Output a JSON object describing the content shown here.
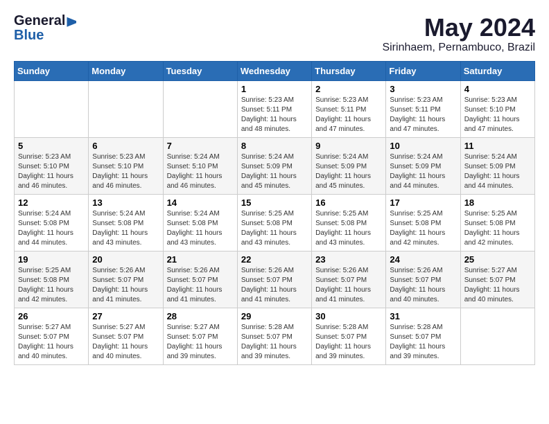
{
  "logo": {
    "general": "General",
    "blue": "Blue"
  },
  "title": "May 2024",
  "subtitle": "Sirinhaem, Pernambuco, Brazil",
  "weekdays": [
    "Sunday",
    "Monday",
    "Tuesday",
    "Wednesday",
    "Thursday",
    "Friday",
    "Saturday"
  ],
  "weeks": [
    [
      {
        "day": "",
        "info": ""
      },
      {
        "day": "",
        "info": ""
      },
      {
        "day": "",
        "info": ""
      },
      {
        "day": "1",
        "info": "Sunrise: 5:23 AM\nSunset: 5:11 PM\nDaylight: 11 hours and 48 minutes."
      },
      {
        "day": "2",
        "info": "Sunrise: 5:23 AM\nSunset: 5:11 PM\nDaylight: 11 hours and 47 minutes."
      },
      {
        "day": "3",
        "info": "Sunrise: 5:23 AM\nSunset: 5:11 PM\nDaylight: 11 hours and 47 minutes."
      },
      {
        "day": "4",
        "info": "Sunrise: 5:23 AM\nSunset: 5:10 PM\nDaylight: 11 hours and 47 minutes."
      }
    ],
    [
      {
        "day": "5",
        "info": "Sunrise: 5:23 AM\nSunset: 5:10 PM\nDaylight: 11 hours and 46 minutes."
      },
      {
        "day": "6",
        "info": "Sunrise: 5:23 AM\nSunset: 5:10 PM\nDaylight: 11 hours and 46 minutes."
      },
      {
        "day": "7",
        "info": "Sunrise: 5:24 AM\nSunset: 5:10 PM\nDaylight: 11 hours and 46 minutes."
      },
      {
        "day": "8",
        "info": "Sunrise: 5:24 AM\nSunset: 5:09 PM\nDaylight: 11 hours and 45 minutes."
      },
      {
        "day": "9",
        "info": "Sunrise: 5:24 AM\nSunset: 5:09 PM\nDaylight: 11 hours and 45 minutes."
      },
      {
        "day": "10",
        "info": "Sunrise: 5:24 AM\nSunset: 5:09 PM\nDaylight: 11 hours and 44 minutes."
      },
      {
        "day": "11",
        "info": "Sunrise: 5:24 AM\nSunset: 5:09 PM\nDaylight: 11 hours and 44 minutes."
      }
    ],
    [
      {
        "day": "12",
        "info": "Sunrise: 5:24 AM\nSunset: 5:08 PM\nDaylight: 11 hours and 44 minutes."
      },
      {
        "day": "13",
        "info": "Sunrise: 5:24 AM\nSunset: 5:08 PM\nDaylight: 11 hours and 43 minutes."
      },
      {
        "day": "14",
        "info": "Sunrise: 5:24 AM\nSunset: 5:08 PM\nDaylight: 11 hours and 43 minutes."
      },
      {
        "day": "15",
        "info": "Sunrise: 5:25 AM\nSunset: 5:08 PM\nDaylight: 11 hours and 43 minutes."
      },
      {
        "day": "16",
        "info": "Sunrise: 5:25 AM\nSunset: 5:08 PM\nDaylight: 11 hours and 43 minutes."
      },
      {
        "day": "17",
        "info": "Sunrise: 5:25 AM\nSunset: 5:08 PM\nDaylight: 11 hours and 42 minutes."
      },
      {
        "day": "18",
        "info": "Sunrise: 5:25 AM\nSunset: 5:08 PM\nDaylight: 11 hours and 42 minutes."
      }
    ],
    [
      {
        "day": "19",
        "info": "Sunrise: 5:25 AM\nSunset: 5:08 PM\nDaylight: 11 hours and 42 minutes."
      },
      {
        "day": "20",
        "info": "Sunrise: 5:26 AM\nSunset: 5:07 PM\nDaylight: 11 hours and 41 minutes."
      },
      {
        "day": "21",
        "info": "Sunrise: 5:26 AM\nSunset: 5:07 PM\nDaylight: 11 hours and 41 minutes."
      },
      {
        "day": "22",
        "info": "Sunrise: 5:26 AM\nSunset: 5:07 PM\nDaylight: 11 hours and 41 minutes."
      },
      {
        "day": "23",
        "info": "Sunrise: 5:26 AM\nSunset: 5:07 PM\nDaylight: 11 hours and 41 minutes."
      },
      {
        "day": "24",
        "info": "Sunrise: 5:26 AM\nSunset: 5:07 PM\nDaylight: 11 hours and 40 minutes."
      },
      {
        "day": "25",
        "info": "Sunrise: 5:27 AM\nSunset: 5:07 PM\nDaylight: 11 hours and 40 minutes."
      }
    ],
    [
      {
        "day": "26",
        "info": "Sunrise: 5:27 AM\nSunset: 5:07 PM\nDaylight: 11 hours and 40 minutes."
      },
      {
        "day": "27",
        "info": "Sunrise: 5:27 AM\nSunset: 5:07 PM\nDaylight: 11 hours and 40 minutes."
      },
      {
        "day": "28",
        "info": "Sunrise: 5:27 AM\nSunset: 5:07 PM\nDaylight: 11 hours and 39 minutes."
      },
      {
        "day": "29",
        "info": "Sunrise: 5:28 AM\nSunset: 5:07 PM\nDaylight: 11 hours and 39 minutes."
      },
      {
        "day": "30",
        "info": "Sunrise: 5:28 AM\nSunset: 5:07 PM\nDaylight: 11 hours and 39 minutes."
      },
      {
        "day": "31",
        "info": "Sunrise: 5:28 AM\nSunset: 5:07 PM\nDaylight: 11 hours and 39 minutes."
      },
      {
        "day": "",
        "info": ""
      }
    ]
  ]
}
